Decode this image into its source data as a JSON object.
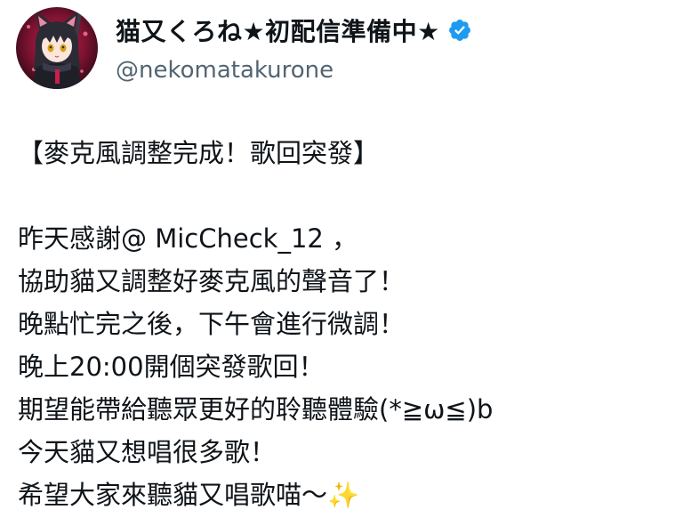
{
  "tweet": {
    "author": {
      "display_name": "猫又くろね★初配信準備中★",
      "handle": "@nekomatakurone",
      "verified": true,
      "verified_icon": "verified-badge-icon",
      "avatar_icon": "avatar"
    },
    "lines": [
      "【麥克風調整完成！歌回突發】",
      "",
      "昨天感謝@ MicCheck_12 ，",
      "協助貓又調整好麥克風的聲音了！",
      "晚點忙完之後，下午會進行微調！",
      "晚上20:00開個突發歌回！",
      "期望能帶給聽眾更好的聆聽體驗(*≧ω≦)b",
      "今天貓又想唱很多歌！",
      "希望大家來聽貓又唱歌喵～✨"
    ]
  },
  "colors": {
    "text": "#0f1419",
    "secondary": "#536471",
    "verified": "#1d9bf0",
    "sparkle": "#f5c542"
  }
}
